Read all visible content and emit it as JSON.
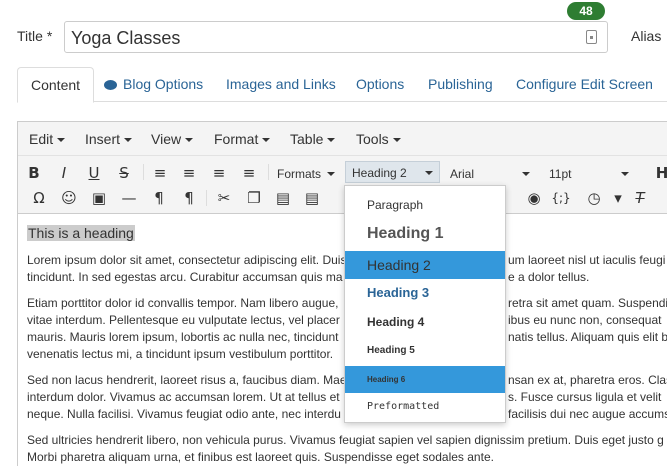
{
  "title_field": {
    "label": "Title *",
    "value": "Yoga Classes",
    "char_count": "48"
  },
  "alias_label": "Alias",
  "tabs": [
    "Content",
    "Blog Options",
    "Images and Links",
    "Options",
    "Publishing",
    "Configure Edit Screen"
  ],
  "menubar": [
    "Edit",
    "Insert",
    "View",
    "Format",
    "Table",
    "Tools"
  ],
  "toolbar": {
    "formats": "Formats",
    "block": "Heading 2",
    "font": "Arial",
    "size": "11pt"
  },
  "content": {
    "heading": "This is a heading",
    "lines": [
      "Lorem ipsum dolor sit amet, consectetur adipiscing elit. Duis",
      "tincidunt. In sed egestas arcu. Curabitur accumsan quis ma",
      "Etiam porttitor dolor id convallis tempor. Nam libero augue,",
      "vitae interdum. Pellentesque eu vulputate lectus, vel placer",
      "mauris. Mauris lorem ipsum, lobortis ac nulla nec, tincidunt",
      "venenatis lectus mi, a tincidunt ipsum vestibulum porttitor.",
      "Sed non lacus hendrerit, laoreet risus a, faucibus diam. Mae",
      "interdum dolor. Vivamus ac accumsan lorem. Ut at tellus et",
      "neque. Nulla facilisi. Vivamus feugiat odio ante, nec interdu",
      "Sed ultricies hendrerit libero, non vehicula purus. Vivamus feugiat sapien vel sapien dignissim pretium. Duis eget justo g",
      "Morbi pharetra aliquam urna, et finibus est laoreet quis. Suspendisse eget sodales ante."
    ],
    "right_lines": [
      "um laoreet nisl ut iaculis feugi",
      "e a dolor tellus.",
      "retra sit amet quam. Suspendi",
      "ibus eu nunc non, consequat",
      "natis tellus. Aliquam quis elit b",
      "",
      "nsan ex at, pharetra eros. Clas",
      "s. Fusce cursus ligula et velit",
      "facilisis dui nec augue accums"
    ]
  },
  "block_formats": [
    {
      "label": "Paragraph"
    },
    {
      "label": "Heading 1"
    },
    {
      "label": "Heading 2"
    },
    {
      "label": "Heading 3"
    },
    {
      "label": "Heading 4"
    },
    {
      "label": "Heading 5"
    },
    {
      "label": "Heading 6"
    },
    {
      "label": "Preformatted"
    }
  ],
  "colors": {
    "accent": "#3498db",
    "link": "#2a6496",
    "badge": "#2e7d32"
  }
}
